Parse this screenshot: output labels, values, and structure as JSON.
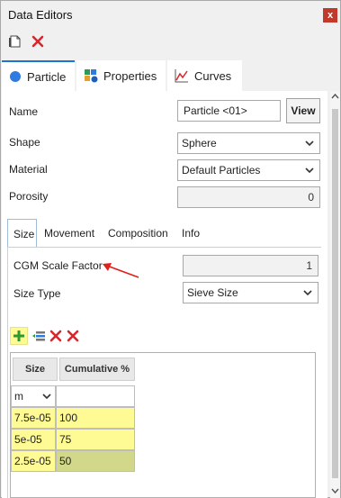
{
  "window": {
    "title": "Data Editors",
    "close_glyph": "x"
  },
  "toolbar": {
    "icons": [
      "new-document-icon",
      "delete-icon"
    ]
  },
  "tabs": [
    {
      "label": "Particle",
      "icon": "particle-circle-icon",
      "active": true
    },
    {
      "label": "Properties",
      "icon": "properties-grid-icon",
      "active": false
    },
    {
      "label": "Curves",
      "icon": "curves-chart-icon",
      "active": false
    }
  ],
  "form": {
    "name_label": "Name",
    "name_value": "Particle <01>",
    "view_button": "View",
    "shape_label": "Shape",
    "shape_value": "Sphere",
    "material_label": "Material",
    "material_value": "Default Particles",
    "porosity_label": "Porosity",
    "porosity_value": "0"
  },
  "subtabs": [
    {
      "label": "Size",
      "active": true
    },
    {
      "label": "Movement",
      "active": false
    },
    {
      "label": "Composition",
      "active": false
    },
    {
      "label": "Info",
      "active": false
    }
  ],
  "size": {
    "cgm_label": "CGM Scale Factor",
    "cgm_value": "1",
    "size_type_label": "Size Type",
    "size_type_value": "Sieve Size"
  },
  "grid": {
    "toolbar_icons": [
      "add-row-icon",
      "insert-row-icon",
      "delete-row-icon",
      "delete-all-rows-icon"
    ],
    "headers": [
      "Size",
      "Cumulative %"
    ],
    "unit": "m",
    "rows": [
      {
        "size": "7.5e-05",
        "cumulative": "100"
      },
      {
        "size": "5e-05",
        "cumulative": "75"
      },
      {
        "size": "2.5e-05",
        "cumulative": "50"
      }
    ]
  },
  "colors": {
    "accent": "#1e73d6",
    "highlight": "#fffb94",
    "selected": "#d2d88a",
    "annotation_arrow": "#e0201b"
  }
}
